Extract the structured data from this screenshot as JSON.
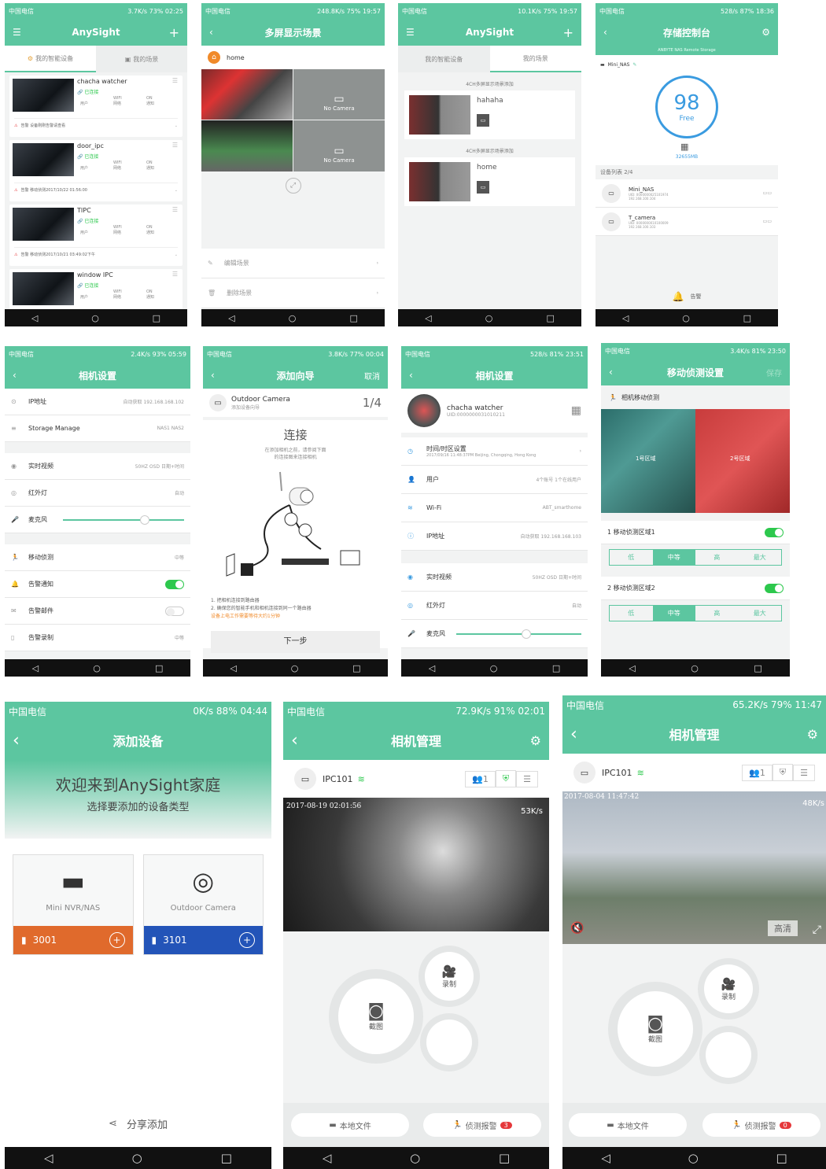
{
  "s1": {
    "status": {
      "left": "中国电信",
      "right": "3.7K/s 73% 02:25"
    },
    "title": "AnySight",
    "tabs": [
      "我的智能设备",
      "我的场景"
    ],
    "devices": [
      {
        "name": "chacha watcher",
        "state": "已连接",
        "labels": [
          "用户",
          "WIFI\n网络",
          "ON\n通知"
        ],
        "foot": "告警 设备刚刚告警请查看"
      },
      {
        "name": "door_ipc",
        "state": "已连接",
        "labels": [
          "用户",
          "WIFI\n网络",
          "ON\n通知"
        ],
        "foot": "告警 移动侦测2017/10/22 01:56:00"
      },
      {
        "name": "TIPC",
        "state": "已连接",
        "labels": [
          "用户",
          "WIFI\n网络",
          "ON\n通知"
        ],
        "foot": "告警 移动侦测2017/10/21 03:49:02下午"
      },
      {
        "name": "window IPC",
        "state": "已连接",
        "labels": [
          "用户",
          "WIFI\n网络",
          "ON\n通知"
        ],
        "foot": ""
      }
    ]
  },
  "s2": {
    "status": {
      "left": "中国电信",
      "right": "248.8K/s 75% 19:57"
    },
    "title": "多屏显示场景",
    "home": "home",
    "no_camera": "No Camera",
    "actions": [
      "编辑场景",
      "删除场景"
    ]
  },
  "s3": {
    "status": {
      "left": "中国电信",
      "right": "10.1K/s 75% 19:57"
    },
    "title": "AnySight",
    "tabs": [
      "我的智能设备",
      "我的场景"
    ],
    "scenes": [
      {
        "header": "4CH多屏显示场景添加",
        "name": "hahaha"
      },
      {
        "header": "4CH多屏显示场景添加",
        "name": "home"
      }
    ]
  },
  "s4": {
    "status": {
      "left": "中国电信",
      "right": "528/s 87% 18:36"
    },
    "title": "存储控制台",
    "banner": "ANBYTE NAS Remote Storage",
    "device": "Mini_NAS",
    "free_pct": "98",
    "free_label": "Free",
    "capacity": "32655MB",
    "list_title": "设备列表 2/4",
    "items": [
      {
        "name": "Mini_NAS",
        "uid": "UID: 0000000025101974",
        "ip": "192.168.100.104"
      },
      {
        "name": "T_camera",
        "uid": "UID: 0000000010100009",
        "ip": "192.168.100.103"
      }
    ],
    "alarm": "告警"
  },
  "s5": {
    "status": {
      "left": "中国电信",
      "right": "2.4K/s 93% 05:59"
    },
    "title": "相机设置",
    "rows": [
      {
        "label": "IP地址",
        "value": "自动获取 192.168.168.102"
      },
      {
        "label": "Storage Manage",
        "value": "NAS1 NAS2"
      },
      {
        "label": "实时视频",
        "value": "50HZ OSD 日期+时间"
      },
      {
        "label": "红外灯",
        "value": "自动"
      },
      {
        "label": "麦克风",
        "value": ""
      },
      {
        "label": "移动侦测",
        "value": "中等"
      },
      {
        "label": "告警通知",
        "value": ""
      },
      {
        "label": "告警邮件",
        "value": ""
      },
      {
        "label": "告警录制",
        "value": "中等"
      }
    ]
  },
  "s6": {
    "status": {
      "left": "中国电信",
      "right": "3.8K/s 77% 00:04"
    },
    "title": "添加向导",
    "cancel": "取消",
    "camera": "Outdoor Camera",
    "sub": "添加设备向导",
    "step": "1/4",
    "heading": "连接",
    "desc1": "在添加相机之前，请参阅下面",
    "desc2": "的连接图来连接相机",
    "note1": "1. 把相机连接到路由器",
    "note2": "2. 确保您的智能手机和相机连接到同一个路由器",
    "note3": "设备上电工作需要等待大约1分钟",
    "next": "下一步"
  },
  "s7": {
    "status": {
      "left": "中国电信",
      "right": "528/s 81% 23:51"
    },
    "title": "相机设置",
    "camera": "chacha watcher",
    "uid": "UID:0000000031010211",
    "rows": [
      {
        "label": "时间/时区设置",
        "value": "2017/09/16 11:48:37PM Beijing, Chongqing, Hong Kong"
      },
      {
        "label": "用户",
        "value": "4个账号 1个在线用户"
      },
      {
        "label": "Wi-Fi",
        "value": "ABT_smarthome"
      },
      {
        "label": "IP地址",
        "value": "自动获取 192.168.168.103"
      },
      {
        "label": "实时视频",
        "value": "50HZ OSD 日期+时间"
      },
      {
        "label": "红外灯",
        "value": "自动"
      },
      {
        "label": "麦克风",
        "value": ""
      }
    ]
  },
  "s8": {
    "status": {
      "left": "中国电信",
      "right": "3.4K/s 81% 23:50"
    },
    "title": "移动侦测设置",
    "save": "保存",
    "section": "相机移动侦测",
    "zone1": "1号区域",
    "zone2": "2号区域",
    "areas": [
      {
        "label": "1 移动侦测区域1",
        "levels": [
          "低",
          "中等",
          "高",
          "最大"
        ],
        "active": 1
      },
      {
        "label": "2 移动侦测区域2",
        "levels": [
          "低",
          "中等",
          "高",
          "最大"
        ],
        "active": 1
      }
    ]
  },
  "s9": {
    "status": {
      "left": "中国电信",
      "right": "0K/s 88% 04:44"
    },
    "title": "添加设备",
    "welcome": "欢迎来到AnySight家庭",
    "prompt": "选择要添加的设备类型",
    "types": [
      {
        "name": "Mini NVR/NAS",
        "code": "3001",
        "color": "#e06a2c"
      },
      {
        "name": "Outdoor Camera",
        "code": "3101",
        "color": "#2354b8"
      }
    ],
    "share": "分享添加"
  },
  "s10": {
    "status": {
      "left": "中国电信",
      "right": "72.9K/s 91% 02:01"
    },
    "title": "相机管理",
    "camera": "IPC101",
    "users": "1",
    "stamp": "2017-08-19 02:01:56",
    "rate": "53K/s",
    "record": "录制",
    "snap": "截图",
    "local": "本地文件",
    "alarm": "侦测报警",
    "alarm_count": "3"
  },
  "s11": {
    "status": {
      "left": "中国电信",
      "right": "65.2K/s 79% 11:47"
    },
    "title": "相机管理",
    "camera": "IPC101",
    "users": "1",
    "stamp": "2017-08-04 11:47:42",
    "rate": "48K/s",
    "hd": "高清",
    "record": "录制",
    "snap": "截图",
    "local": "本地文件",
    "alarm": "侦测报警",
    "alarm_count": "0"
  },
  "nav": [
    "◁",
    "○",
    "□"
  ]
}
